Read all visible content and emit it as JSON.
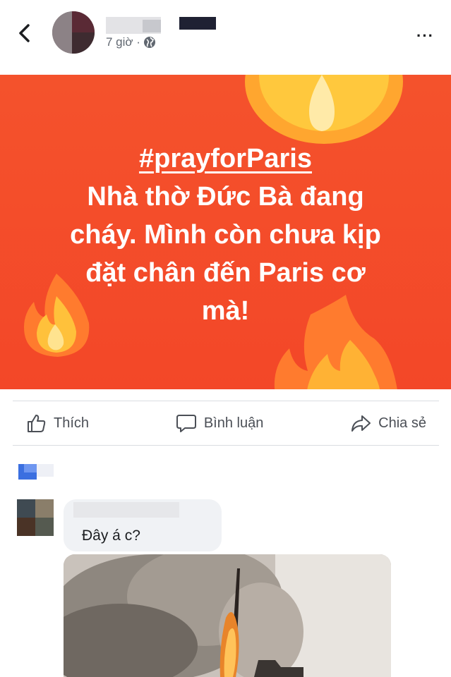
{
  "header": {
    "back_icon": "chevron-left-icon",
    "time_text": "7 giờ ·",
    "privacy_icon": "globe-icon",
    "more_icon": "more-horizontal-icon",
    "more_label": "···"
  },
  "post": {
    "hashtag": "#prayforParis",
    "lines": [
      "Nhà thờ Đức Bà đang",
      "cháy. Mình còn chưa kịp",
      "đặt chân đến Paris cơ",
      "mà!"
    ],
    "background_color": "#f34a2a"
  },
  "actions": [
    {
      "label": "Thích",
      "icon": "like-icon"
    },
    {
      "label": "Bình luận",
      "icon": "comment-icon"
    },
    {
      "label": "Chia sẻ",
      "icon": "share-icon"
    }
  ],
  "comment": {
    "text": "Đây á c?"
  }
}
